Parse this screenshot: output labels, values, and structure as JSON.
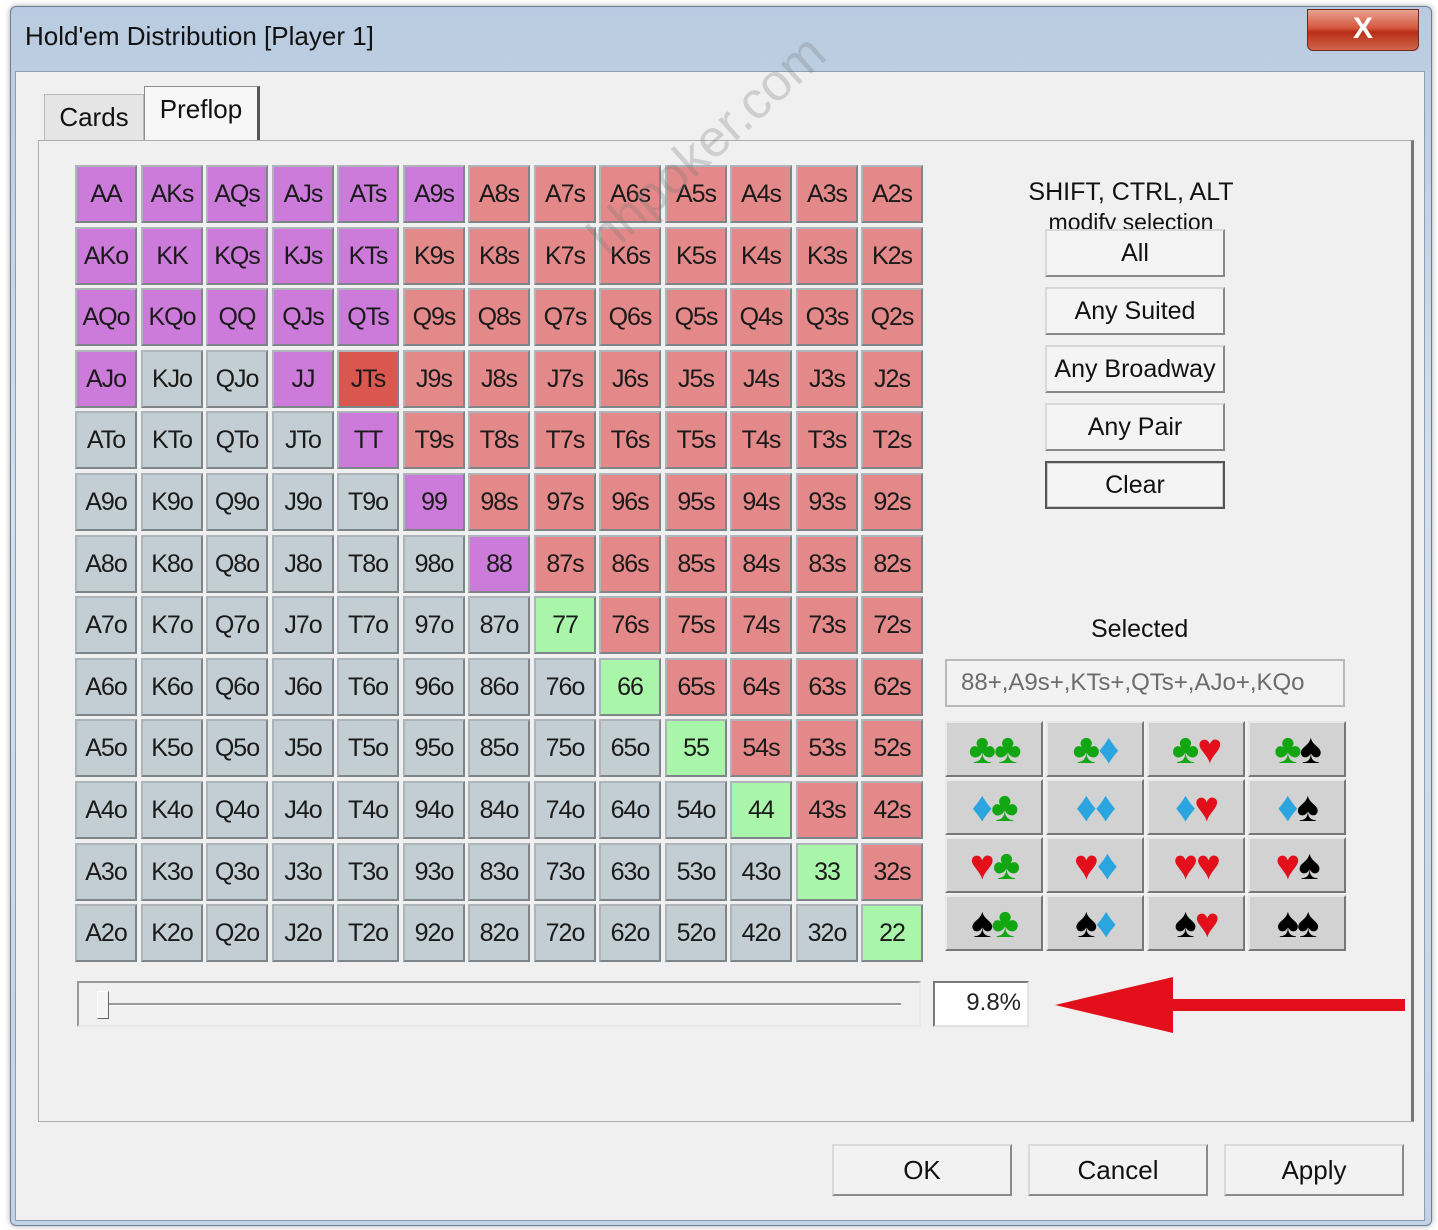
{
  "window": {
    "title": "Hold'em Distribution [Player 1]",
    "close_label": "X"
  },
  "tabs": [
    {
      "label": "Cards",
      "active": false
    },
    {
      "label": "Preflop",
      "active": true
    }
  ],
  "grid": {
    "rows": [
      [
        "AA",
        "AKs",
        "AQs",
        "AJs",
        "ATs",
        "A9s",
        "A8s",
        "A7s",
        "A6s",
        "A5s",
        "A4s",
        "A3s",
        "A2s"
      ],
      [
        "AKo",
        "KK",
        "KQs",
        "KJs",
        "KTs",
        "K9s",
        "K8s",
        "K7s",
        "K6s",
        "K5s",
        "K4s",
        "K3s",
        "K2s"
      ],
      [
        "AQo",
        "KQo",
        "QQ",
        "QJs",
        "QTs",
        "Q9s",
        "Q8s",
        "Q7s",
        "Q6s",
        "Q5s",
        "Q4s",
        "Q3s",
        "Q2s"
      ],
      [
        "AJo",
        "KJo",
        "QJo",
        "JJ",
        "JTs",
        "J9s",
        "J8s",
        "J7s",
        "J6s",
        "J5s",
        "J4s",
        "J3s",
        "J2s"
      ],
      [
        "ATo",
        "KTo",
        "QTo",
        "JTo",
        "TT",
        "T9s",
        "T8s",
        "T7s",
        "T6s",
        "T5s",
        "T4s",
        "T3s",
        "T2s"
      ],
      [
        "A9o",
        "K9o",
        "Q9o",
        "J9o",
        "T9o",
        "99",
        "98s",
        "97s",
        "96s",
        "95s",
        "94s",
        "93s",
        "92s"
      ],
      [
        "A8o",
        "K8o",
        "Q8o",
        "J8o",
        "T8o",
        "98o",
        "88",
        "87s",
        "86s",
        "85s",
        "84s",
        "83s",
        "82s"
      ],
      [
        "A7o",
        "K7o",
        "Q7o",
        "J7o",
        "T7o",
        "97o",
        "87o",
        "77",
        "76s",
        "75s",
        "74s",
        "73s",
        "72s"
      ],
      [
        "A6o",
        "K6o",
        "Q6o",
        "J6o",
        "T6o",
        "96o",
        "86o",
        "76o",
        "66",
        "65s",
        "64s",
        "63s",
        "62s"
      ],
      [
        "A5o",
        "K5o",
        "Q5o",
        "J5o",
        "T5o",
        "95o",
        "85o",
        "75o",
        "65o",
        "55",
        "54s",
        "53s",
        "52s"
      ],
      [
        "A4o",
        "K4o",
        "Q4o",
        "J4o",
        "T4o",
        "94o",
        "84o",
        "74o",
        "64o",
        "54o",
        "44",
        "43s",
        "42s"
      ],
      [
        "A3o",
        "K3o",
        "Q3o",
        "J3o",
        "T3o",
        "93o",
        "83o",
        "73o",
        "63o",
        "53o",
        "43o",
        "33",
        "32s"
      ],
      [
        "A2o",
        "K2o",
        "Q2o",
        "J2o",
        "T2o",
        "92o",
        "82o",
        "72o",
        "62o",
        "52o",
        "42o",
        "32o",
        "22"
      ]
    ],
    "selected": [
      "AA",
      "AKs",
      "AQs",
      "AJs",
      "ATs",
      "A9s",
      "AKo",
      "KK",
      "KQs",
      "KJs",
      "KTs",
      "AQo",
      "KQo",
      "QQ",
      "QJs",
      "QTs",
      "AJo",
      "JJ",
      "TT",
      "99",
      "88"
    ],
    "colors": {
      "offsuit": "#c3ced4",
      "suited": "#e48989",
      "pair": "#a9f5a9",
      "selected": "#cd7bdb",
      "highlight": "#d9574f"
    }
  },
  "modify": {
    "line1": "SHIFT, CTRL, ALT",
    "line2": "modify selection",
    "buttons": {
      "all": "All",
      "any_suited": "Any Suited",
      "any_broadway": "Any Broadway",
      "any_pair": "Any Pair",
      "clear": "Clear"
    }
  },
  "selected_panel": {
    "label": "Selected",
    "value": "88+,A9s+,KTs+,QTs+,AJo+,KQo"
  },
  "combo_matrix": {
    "rows": [
      [
        [
          "club",
          "club"
        ],
        [
          "club",
          "diamond"
        ],
        [
          "club",
          "heart"
        ],
        [
          "club",
          "spade"
        ]
      ],
      [
        [
          "diamond",
          "club"
        ],
        [
          "diamond",
          "diamond"
        ],
        [
          "diamond",
          "heart"
        ],
        [
          "diamond",
          "spade"
        ]
      ],
      [
        [
          "heart",
          "club"
        ],
        [
          "heart",
          "diamond"
        ],
        [
          "heart",
          "heart"
        ],
        [
          "heart",
          "spade"
        ]
      ],
      [
        [
          "spade",
          "club"
        ],
        [
          "spade",
          "diamond"
        ],
        [
          "spade",
          "heart"
        ],
        [
          "spade",
          "spade"
        ]
      ]
    ],
    "suit_colors": {
      "club": "#13a613",
      "diamond": "#2aa5e0",
      "heart": "#e3101b",
      "spade": "#000000"
    }
  },
  "range": {
    "percent_label": "9.8%",
    "percent": 9.8,
    "annotation_color": "#e3101b"
  },
  "footer": {
    "ok": "OK",
    "cancel": "Cancel",
    "apply": "Apply"
  },
  "watermark": "hhpoker.com"
}
